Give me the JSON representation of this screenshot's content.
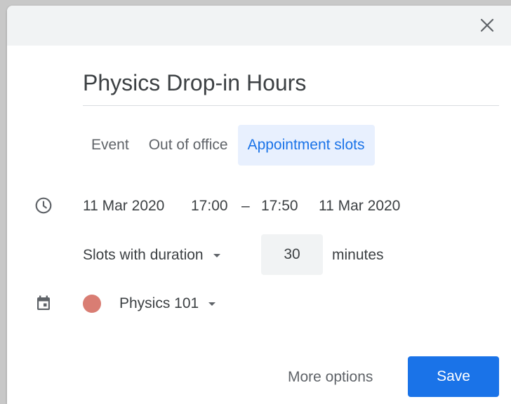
{
  "header": {
    "close_icon": "close-icon"
  },
  "title": {
    "value": "Physics Drop-in Hours"
  },
  "tabs": [
    {
      "label": "Event",
      "active": false
    },
    {
      "label": "Out of office",
      "active": false
    },
    {
      "label": "Appointment slots",
      "active": true
    }
  ],
  "datetime": {
    "icon": "clock-icon",
    "start_date": "11 Mar 2020",
    "start_time": "17:00",
    "separator": "–",
    "end_time": "17:50",
    "end_date": "11 Mar 2020"
  },
  "slots": {
    "mode_label": "Slots with duration",
    "duration_value": "30",
    "unit_label": "minutes"
  },
  "calendar": {
    "icon": "calendar-icon",
    "color": "#d97d73",
    "name": "Physics 101"
  },
  "footer": {
    "more_options_label": "More options",
    "save_label": "Save",
    "save_color": "#1a73e8"
  }
}
